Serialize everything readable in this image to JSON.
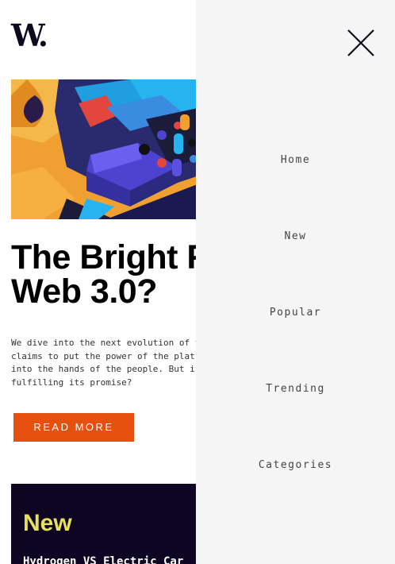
{
  "header": {
    "logo_text": "W."
  },
  "article": {
    "headline_line1": "The Bright F",
    "headline_line2": "Web 3.0?",
    "excerpt_lines": [
      "We dive into the next evolution of t",
      "claims to put the power of the platf",
      "into the hands of the people. But is",
      "fulfilling its promise?"
    ],
    "read_more_label": "READ MORE"
  },
  "new_panel": {
    "title": "New",
    "first_item": "Hydrogen VS Electric Car"
  },
  "menu": {
    "close_icon": "close-icon",
    "items": [
      {
        "label": "Home"
      },
      {
        "label": "New"
      },
      {
        "label": "Popular"
      },
      {
        "label": "Trending"
      },
      {
        "label": "Categories"
      }
    ]
  },
  "colors": {
    "accent": "#e5500f",
    "dark": "#0d0a1f",
    "new_panel_bg": "#0d0522",
    "new_title": "#e6e05a",
    "menu_bg": "#f5f5f5"
  }
}
